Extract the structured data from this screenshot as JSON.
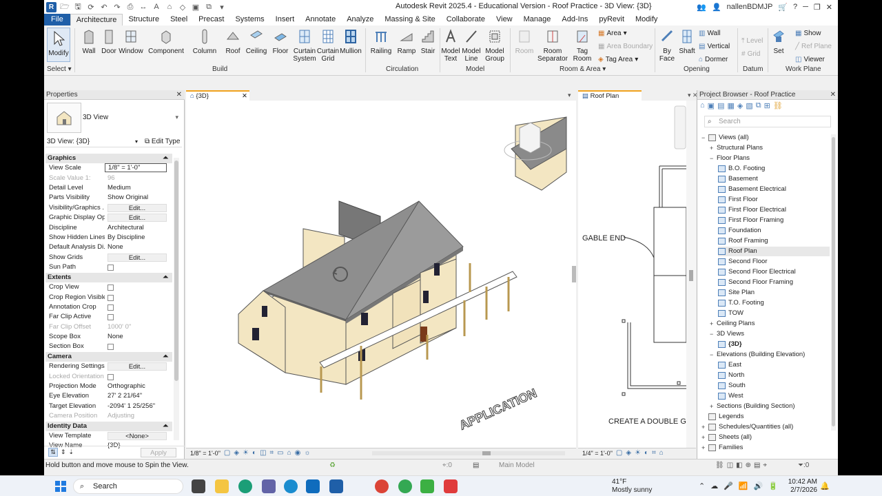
{
  "window": {
    "title": "Autodesk Revit 2025.4 - Educational Version - Roof Practice - 3D View: {3D}",
    "user": "nallenBDMJP"
  },
  "tabs": [
    "File",
    "Architecture",
    "Structure",
    "Steel",
    "Precast",
    "Systems",
    "Insert",
    "Annotate",
    "Analyze",
    "Massing & Site",
    "Collaborate",
    "View",
    "Manage",
    "Add-Ins",
    "pyRevit",
    "Modify"
  ],
  "ribbon": {
    "select": {
      "modify": "Modify",
      "select": "Select"
    },
    "build": {
      "wall": "Wall",
      "door": "Door",
      "window": "Window",
      "component": "Component",
      "column": "Column",
      "roof": "Roof",
      "ceiling": "Ceiling",
      "floor": "Floor",
      "curtain_system": "Curtain System",
      "curtain_grid": "Curtain Grid",
      "mullion": "Mullion",
      "label": "Build"
    },
    "circulation": {
      "railing": "Railing",
      "ramp": "Ramp",
      "stair": "Stair",
      "label": "Circulation"
    },
    "model": {
      "model_text": "Model Text",
      "model_line": "Model Line",
      "model_group": "Model Group",
      "label": "Model"
    },
    "room": {
      "room": "Room",
      "room_separator": "Room Separator",
      "tag_room": "Tag Room",
      "area": "Area",
      "area_boundary": "Area Boundary",
      "tag_area": "Tag Area",
      "label": "Room & Area"
    },
    "opening": {
      "by_face": "By Face",
      "shaft": "Shaft",
      "wall": "Wall",
      "vertical": "Vertical",
      "dormer": "Dormer",
      "label": "Opening"
    },
    "datum": {
      "level": "Level",
      "grid": "Grid",
      "label": "Datum"
    },
    "workplane": {
      "set": "Set",
      "show": "Show",
      "ref_plane": "Ref Plane",
      "viewer": "Viewer",
      "label": "Work Plane"
    }
  },
  "properties": {
    "title": "Properties",
    "type": "3D View",
    "selector": "3D View: {3D}",
    "edit_type": "Edit Type",
    "sections": {
      "graphics": "Graphics",
      "extents": "Extents",
      "camera": "Camera",
      "identity": "Identity Data"
    },
    "rows": {
      "view_scale": [
        "View Scale",
        "1/8\" = 1'-0\""
      ],
      "scale_value": [
        "Scale Value    1:",
        "96"
      ],
      "detail_level": [
        "Detail Level",
        "Medium"
      ],
      "parts_vis": [
        "Parts Visibility",
        "Show Original"
      ],
      "vis_graphics": [
        "Visibility/Graphics ...",
        "Edit..."
      ],
      "graphic_disp": [
        "Graphic Display Op...",
        "Edit..."
      ],
      "discipline": [
        "Discipline",
        "Architectural"
      ],
      "hidden_lines": [
        "Show Hidden Lines",
        "By Discipline"
      ],
      "analysis": [
        "Default Analysis Di...",
        "None"
      ],
      "show_grids": [
        "Show Grids",
        "Edit..."
      ],
      "sun_path": [
        "Sun Path",
        ""
      ],
      "crop_view": [
        "Crop View",
        ""
      ],
      "crop_region": [
        "Crop Region Visible",
        ""
      ],
      "annotation_crop": [
        "Annotation Crop",
        ""
      ],
      "far_clip_active": [
        "Far Clip Active",
        ""
      ],
      "far_clip_offset": [
        "Far Clip Offset",
        "1000'  0\""
      ],
      "scope_box": [
        "Scope Box",
        "None"
      ],
      "section_box": [
        "Section Box",
        ""
      ],
      "rendering": [
        "Rendering Settings",
        "Edit..."
      ],
      "locked_orient": [
        "Locked Orientation",
        ""
      ],
      "projection": [
        "Projection Mode",
        "Orthographic"
      ],
      "eye_elev": [
        "Eye Elevation",
        "27'  2 21/64\""
      ],
      "target_elev": [
        "Target Elevation",
        "-2094'  1 25/256\""
      ],
      "camera_pos": [
        "Camera Position",
        "Adjusting"
      ],
      "view_template": [
        "View Template",
        "<None>"
      ],
      "view_name": [
        "View Name",
        "{3D}"
      ]
    },
    "apply": "Apply"
  },
  "views": {
    "tab_3d": "{3D}",
    "tab_roof": "Roof Plan",
    "scale_3d": "1/8\" = 1'-0\"",
    "scale_roof": "1/4\" = 1'-0\"",
    "gable_note": "GABLE END",
    "double_note": "CREATE A DOUBLE GA",
    "application_text": "APPLICATION"
  },
  "browser": {
    "title": "Project Browser - Roof Practice",
    "search_placeholder": "Search",
    "nodes": [
      {
        "label": "Views (all)",
        "level": 0,
        "toggle": "−"
      },
      {
        "label": "Structural Plans",
        "level": 1,
        "toggle": "+"
      },
      {
        "label": "Floor Plans",
        "level": 1,
        "toggle": "−"
      },
      {
        "label": "B.O. Footing",
        "level": 2
      },
      {
        "label": "Basement",
        "level": 2
      },
      {
        "label": "Basement Electrical",
        "level": 2
      },
      {
        "label": "First Floor",
        "level": 2
      },
      {
        "label": "First Floor Electrical",
        "level": 2
      },
      {
        "label": "First Floor Framing",
        "level": 2
      },
      {
        "label": "Foundation",
        "level": 2
      },
      {
        "label": "Roof Framing",
        "level": 2
      },
      {
        "label": "Roof Plan",
        "level": 2,
        "selected": true
      },
      {
        "label": "Second Floor",
        "level": 2
      },
      {
        "label": "Second Floor Electrical",
        "level": 2
      },
      {
        "label": "Second Floor Framing",
        "level": 2
      },
      {
        "label": "Site Plan",
        "level": 2
      },
      {
        "label": "T.O. Footing",
        "level": 2
      },
      {
        "label": "TOW",
        "level": 2
      },
      {
        "label": "Ceiling Plans",
        "level": 1,
        "toggle": "+"
      },
      {
        "label": "3D Views",
        "level": 1,
        "toggle": "−"
      },
      {
        "label": "{3D}",
        "level": 2,
        "bold": true
      },
      {
        "label": "Elevations (Building Elevation)",
        "level": 1,
        "toggle": "−"
      },
      {
        "label": "East",
        "level": 2
      },
      {
        "label": "North",
        "level": 2
      },
      {
        "label": "South",
        "level": 2
      },
      {
        "label": "West",
        "level": 2
      },
      {
        "label": "Sections (Building Section)",
        "level": 1,
        "toggle": "+"
      },
      {
        "label": "Legends",
        "level": 0,
        "toggle": ""
      },
      {
        "label": "Schedules/Quantities (all)",
        "level": 0,
        "toggle": "+"
      },
      {
        "label": "Sheets (all)",
        "level": 0,
        "toggle": "+"
      },
      {
        "label": "Families",
        "level": 0,
        "toggle": "+"
      }
    ]
  },
  "status": {
    "message": "Hold button and move mouse to Spin the View.",
    "zero": ":0",
    "model": "Main Model",
    "filter": ":0"
  },
  "taskbar": {
    "search": "Search",
    "temp": "41°F",
    "weather": "Mostly sunny",
    "time": "10:42 AM",
    "date": "2/7/2026"
  }
}
